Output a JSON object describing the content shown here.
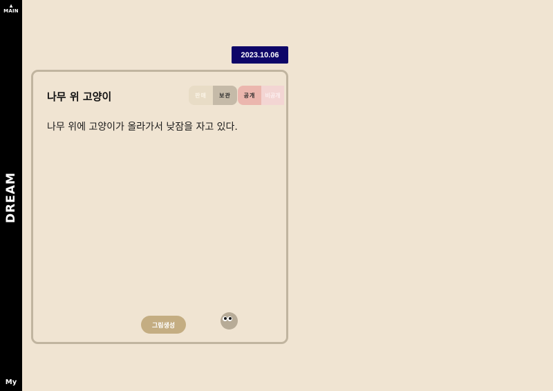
{
  "sidebar": {
    "main_label": "MAIN",
    "brand": "DREAM",
    "my_label": "My"
  },
  "diary": {
    "date": "2023.10.06",
    "title": "나무 위 고양이",
    "content": "나무 위에 고양이가 올라가서 낮잠을 자고 있다.",
    "toggles": {
      "sell": "판매",
      "keep": "보관",
      "public": "공개",
      "private": "비공개"
    },
    "generate_button": "그림생성"
  },
  "colors": {
    "background": "#f0e4d2",
    "sidebar": "#000000",
    "date_badge": "#0e0668",
    "card_border": "#c0b49f",
    "generate_button": "#c4ad82",
    "public_active": "#ebb6ae"
  },
  "icons": {
    "main": "crown-icon",
    "mascot": "mascot-eyes-icon"
  }
}
